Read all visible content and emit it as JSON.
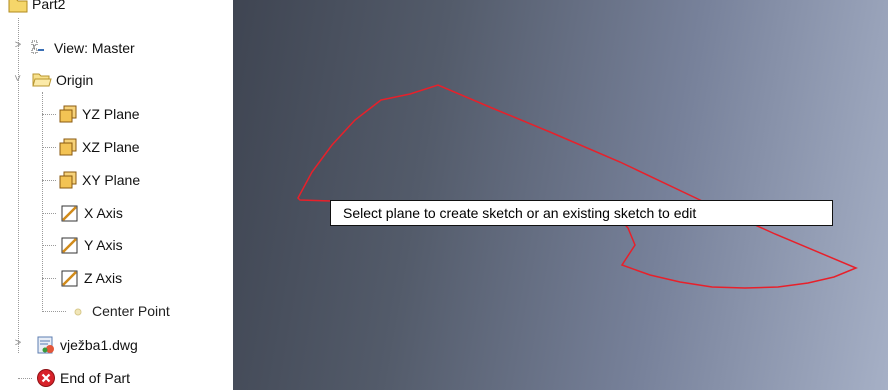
{
  "browser": {
    "part_name": "Part2",
    "items": [
      {
        "label": "View: Master",
        "icon": "view-representation-icon"
      },
      {
        "label": "Origin",
        "icon": "folder-icon"
      },
      {
        "label": "YZ Plane",
        "icon": "work-plane-icon"
      },
      {
        "label": "XZ Plane",
        "icon": "work-plane-icon"
      },
      {
        "label": "XY Plane",
        "icon": "work-plane-icon"
      },
      {
        "label": "X Axis",
        "icon": "work-axis-icon"
      },
      {
        "label": "Y Axis",
        "icon": "work-axis-icon"
      },
      {
        "label": "Z Axis",
        "icon": "work-axis-icon"
      },
      {
        "label": "Center Point",
        "icon": "work-point-icon"
      },
      {
        "label": "vježba1.dwg",
        "icon": "dwg-file-icon"
      },
      {
        "label": "End of Part",
        "icon": "end-of-part-icon"
      }
    ]
  },
  "viewport": {
    "tooltip": "Select plane to create sketch or an existing sketch to edit",
    "sketch_color": "#e8202a"
  }
}
